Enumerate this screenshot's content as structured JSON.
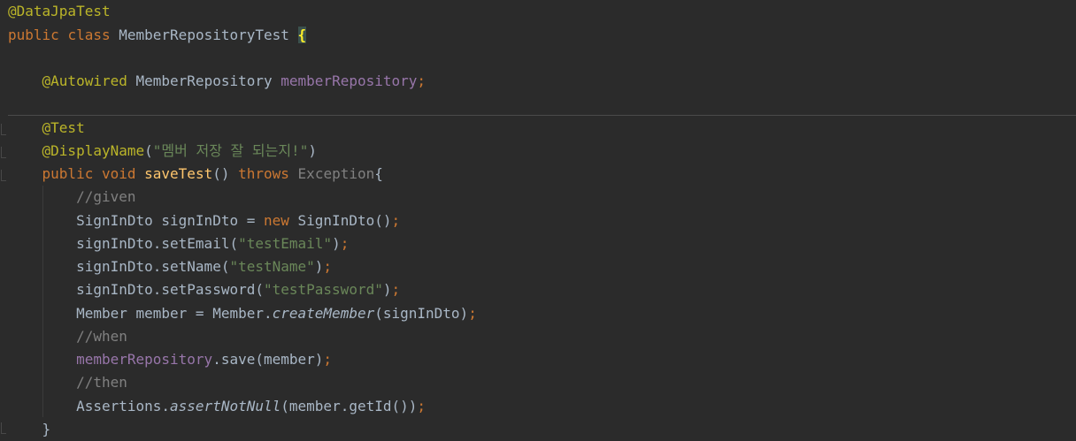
{
  "code": {
    "class_annotation": "@DataJpaTest",
    "class_kw_public": "public",
    "class_kw_class": "class",
    "class_name": "MemberRepositoryTest",
    "open_brace": "{",
    "autowired_annotation": "@Autowired",
    "field_type": "MemberRepository",
    "field_name": "memberRepository",
    "semicolon": ";",
    "test_annotation": "@Test",
    "display_name_annotation": "@DisplayName",
    "display_name_open": "(",
    "display_name_string": "\"멤버 저장 잘 되는지!\"",
    "display_name_close": ")",
    "method_public": "public",
    "method_void": "void",
    "method_name": "saveTest",
    "method_parens": "()",
    "method_throws": "throws",
    "method_exception": "Exception",
    "method_open_brace": "{",
    "comment_given": "//given",
    "line_dto_decl": "SignInDto signInDto = ",
    "kw_new": "new",
    "line_dto_ctor": " SignInDto()",
    "line_email_call": "signInDto.setEmail(",
    "str_email": "\"testEmail\"",
    "line_name_call": "signInDto.setName(",
    "str_name": "\"testName\"",
    "line_password_call": "signInDto.setPassword(",
    "str_password": "\"testPassword\"",
    "close_paren": ")",
    "line_member_decl": "Member member = Member.",
    "create_member": "createMember",
    "line_member_args": "(signInDto)",
    "comment_when": "//when",
    "save_field": "memberRepository",
    "save_call": ".save(member)",
    "comment_then": "//then",
    "assertions_prefix": "Assertions.",
    "assert_not_null": "assertNotNull",
    "assert_args": "(member.getId())",
    "close_brace": "}"
  }
}
